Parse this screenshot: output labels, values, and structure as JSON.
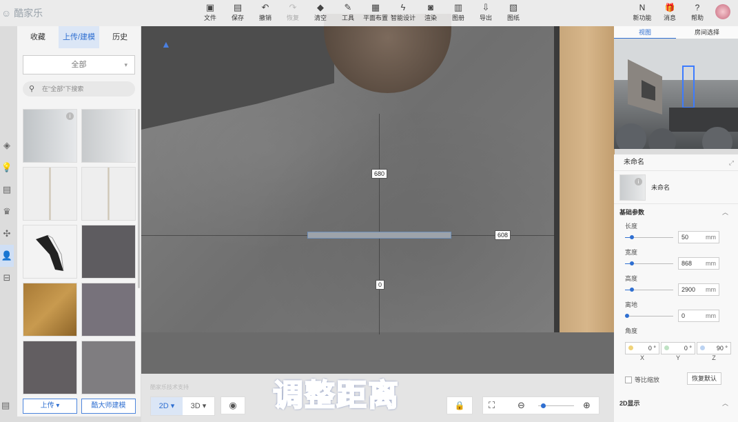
{
  "app": {
    "logo_text": "酷家乐"
  },
  "toolbar": {
    "tools": [
      {
        "label": "文件",
        "icon": "file-icon"
      },
      {
        "label": "保存",
        "icon": "save-icon"
      },
      {
        "label": "撤销",
        "icon": "undo-icon"
      },
      {
        "label": "恢复",
        "icon": "redo-icon",
        "disabled": true
      },
      {
        "label": "清空",
        "icon": "eraser-icon"
      },
      {
        "label": "工具",
        "icon": "wrench-icon"
      },
      {
        "label": "平面布置",
        "icon": "layout-icon"
      },
      {
        "label": "智能设计",
        "icon": "lightning-icon"
      },
      {
        "label": "渲染",
        "icon": "render-icon"
      },
      {
        "label": "图册",
        "icon": "album-icon"
      },
      {
        "label": "导出",
        "icon": "export-icon"
      },
      {
        "label": "图纸",
        "icon": "blueprint-icon"
      }
    ],
    "right": [
      {
        "label": "新功能",
        "icon": "new-feature-icon"
      },
      {
        "label": "消息",
        "icon": "gift-icon"
      },
      {
        "label": "帮助",
        "icon": "help-icon"
      }
    ]
  },
  "left_panel": {
    "tabs": [
      "收藏",
      "上传/建模",
      "历史"
    ],
    "active_tab": 1,
    "filter_value": "全部",
    "search_placeholder": "在\"全部\"下搜索",
    "upload_button": "上传 ▾",
    "modeling_button": "酷大师建模"
  },
  "canvas": {
    "dimensions": {
      "top": "680",
      "right": "608",
      "bottom": "0"
    },
    "caption": "调整距离",
    "tip": "酷家乐技术支持"
  },
  "bottom_bar": {
    "modes": [
      "2D ▾",
      "3D ▾"
    ],
    "active_mode": 0
  },
  "right_panel": {
    "view_tabs": [
      "视图",
      "房间选择"
    ],
    "object_title": "未命名",
    "object_name": "未命名",
    "section_basic": "基础参数",
    "params": [
      {
        "label": "长度",
        "value": "50",
        "unit": "mm",
        "level": 0.1
      },
      {
        "label": "宽度",
        "value": "868",
        "unit": "mm",
        "level": 0.1
      },
      {
        "label": "高度",
        "value": "2900",
        "unit": "mm",
        "level": 0.1
      },
      {
        "label": "离地",
        "value": "0",
        "unit": "mm",
        "level": 0.0
      }
    ],
    "angle_label": "角度",
    "angles": [
      "0 °",
      "0 °",
      "90 °"
    ],
    "axes": [
      "X",
      "Y",
      "Z"
    ],
    "ratio_label": "等比缩放",
    "reset_label": "恢复默认",
    "display_2d": "2D显示"
  },
  "colors": {
    "accent": "#2f6fd1"
  }
}
